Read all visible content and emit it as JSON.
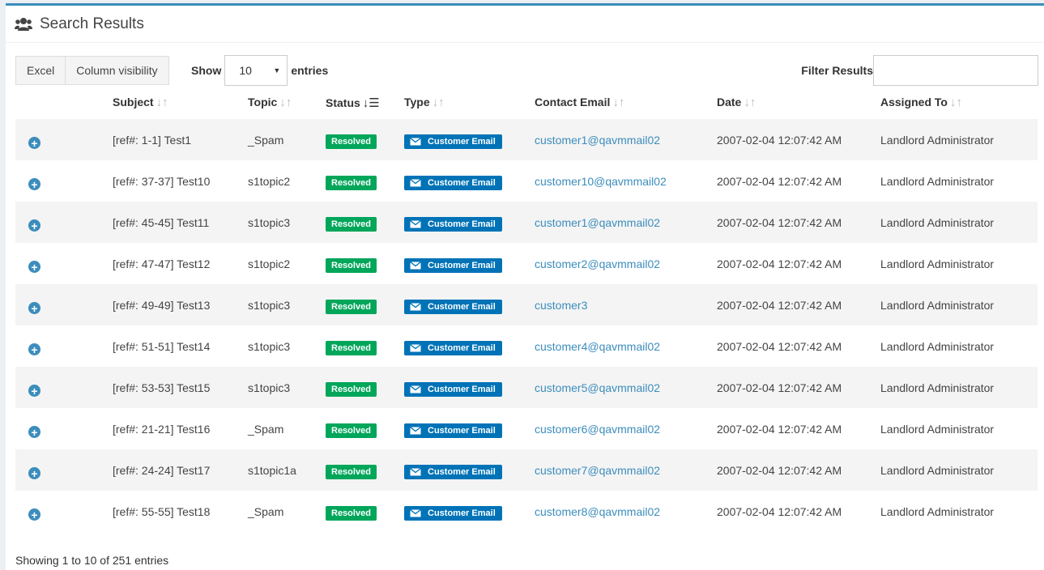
{
  "header": {
    "title": "Search Results",
    "icon": "users-icon"
  },
  "toolbar": {
    "buttons": [
      "Excel",
      "Column visibility"
    ],
    "show_label": "Show",
    "length_value": "10",
    "entries_label": "entries",
    "filter_label": "Filter Results",
    "filter_value": ""
  },
  "table": {
    "columns": [
      "Subject",
      "Topic",
      "Status",
      "Type",
      "Contact Email",
      "Date",
      "Assigned To"
    ],
    "sorted_column": "Status",
    "rows": [
      {
        "subject": "[ref#: 1-1] Test1",
        "topic": "_Spam",
        "status": "Resolved",
        "type": "Customer Email",
        "email": "customer1@qavmmail02",
        "date": "2007-02-04 12:07:42 AM",
        "assigned": "Landlord Administrator"
      },
      {
        "subject": "[ref#: 37-37] Test10",
        "topic": "s1topic2",
        "status": "Resolved",
        "type": "Customer Email",
        "email": "customer10@qavmmail02",
        "date": "2007-02-04 12:07:42 AM",
        "assigned": "Landlord Administrator"
      },
      {
        "subject": "[ref#: 45-45] Test11",
        "topic": "s1topic3",
        "status": "Resolved",
        "type": "Customer Email",
        "email": "customer1@qavmmail02",
        "date": "2007-02-04 12:07:42 AM",
        "assigned": "Landlord Administrator"
      },
      {
        "subject": "[ref#: 47-47] Test12",
        "topic": "s1topic2",
        "status": "Resolved",
        "type": "Customer Email",
        "email": "customer2@qavmmail02",
        "date": "2007-02-04 12:07:42 AM",
        "assigned": "Landlord Administrator"
      },
      {
        "subject": "[ref#: 49-49] Test13",
        "topic": "s1topic3",
        "status": "Resolved",
        "type": "Customer Email",
        "email": "customer3",
        "date": "2007-02-04 12:07:42 AM",
        "assigned": "Landlord Administrator"
      },
      {
        "subject": "[ref#: 51-51] Test14",
        "topic": "s1topic3",
        "status": "Resolved",
        "type": "Customer Email",
        "email": "customer4@qavmmail02",
        "date": "2007-02-04 12:07:42 AM",
        "assigned": "Landlord Administrator"
      },
      {
        "subject": "[ref#: 53-53] Test15",
        "topic": "s1topic3",
        "status": "Resolved",
        "type": "Customer Email",
        "email": "customer5@qavmmail02",
        "date": "2007-02-04 12:07:42 AM",
        "assigned": "Landlord Administrator"
      },
      {
        "subject": "[ref#: 21-21] Test16",
        "topic": "_Spam",
        "status": "Resolved",
        "type": "Customer Email",
        "email": "customer6@qavmmail02",
        "date": "2007-02-04 12:07:42 AM",
        "assigned": "Landlord Administrator"
      },
      {
        "subject": "[ref#: 24-24] Test17",
        "topic": "s1topic1a",
        "status": "Resolved",
        "type": "Customer Email",
        "email": "customer7@qavmmail02",
        "date": "2007-02-04 12:07:42 AM",
        "assigned": "Landlord Administrator"
      },
      {
        "subject": "[ref#: 55-55] Test18",
        "topic": "_Spam",
        "status": "Resolved",
        "type": "Customer Email",
        "email": "customer8@qavmmail02",
        "date": "2007-02-04 12:07:42 AM",
        "assigned": "Landlord Administrator"
      }
    ]
  },
  "footer": {
    "info": "Showing 1 to 10 of 251 entries"
  },
  "colors": {
    "accent": "#3c8dbc",
    "resolved": "#00a65a",
    "type_badge": "#0073b7"
  }
}
